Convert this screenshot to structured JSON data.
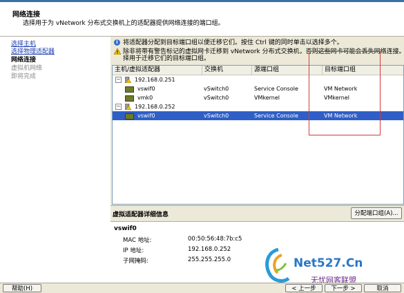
{
  "header": {
    "title": "网络连接",
    "description": "选择用于为 vNetwork 分布式交换机上的适配器提供网络连接的端口组。"
  },
  "nav": {
    "items": [
      {
        "label": "选择主机",
        "state": "link"
      },
      {
        "label": "选择物理适配器",
        "state": "link"
      },
      {
        "label": "网络连接",
        "state": "current"
      },
      {
        "label": "虚拟机网络",
        "state": "disabled"
      },
      {
        "label": "即将完成",
        "state": "disabled"
      }
    ]
  },
  "messages": {
    "info": "将适配器分配到目标端口组以便迁移它们。按住 Ctrl 键的同时单击以选择多个。",
    "warning_line1": "除非将带有警告标记的虚拟网卡迁移到 vNetwork 分布式交换机，否则这些网卡可能会丢失网络连接。请选",
    "warning_line2": "择用于迁移它们的目标端口组。"
  },
  "table": {
    "columns": [
      "主机/虚拟适配器",
      "交换机",
      "源端口组",
      "目标端口组"
    ],
    "rows": [
      {
        "type": "host",
        "name": "192.168.0.251",
        "switch": "",
        "source": "",
        "target": ""
      },
      {
        "type": "nic",
        "name": "vswif0",
        "switch": "vSwitch0",
        "source": "Service Console",
        "target": "VM Network"
      },
      {
        "type": "nic",
        "name": "vmk0",
        "switch": "vSwitch0",
        "source": "VMkernel",
        "target": "VMkernel"
      },
      {
        "type": "host",
        "name": "192.168.0.252",
        "switch": "",
        "source": "",
        "target": ""
      },
      {
        "type": "nic",
        "name": "vswif0",
        "switch": "vSwitch0",
        "source": "Service Console",
        "target": "VM Network",
        "selected": true
      }
    ]
  },
  "details": {
    "section_title": "虚拟适配器详细信息",
    "assign_button": "分配端口组(A)...",
    "adapter_name": "vswif0",
    "fields": [
      {
        "label": "MAC 地址:",
        "value": "00:50:56:48:7b:c5"
      },
      {
        "label": "IP 地址:",
        "value": "192.168.0.252"
      },
      {
        "label": "子网掩码:",
        "value": "255.255.255.0"
      }
    ]
  },
  "footer": {
    "help": "帮助(H)",
    "back": "< 上一步",
    "next": "下一步 >",
    "cancel": "取消"
  },
  "watermark": {
    "brand": "Net527.Cn",
    "slogan": "无忧网客联盟"
  },
  "colors": {
    "selection": "#2f5fc6",
    "link": "#1f3fb0",
    "annotation": "#d43a3a"
  }
}
